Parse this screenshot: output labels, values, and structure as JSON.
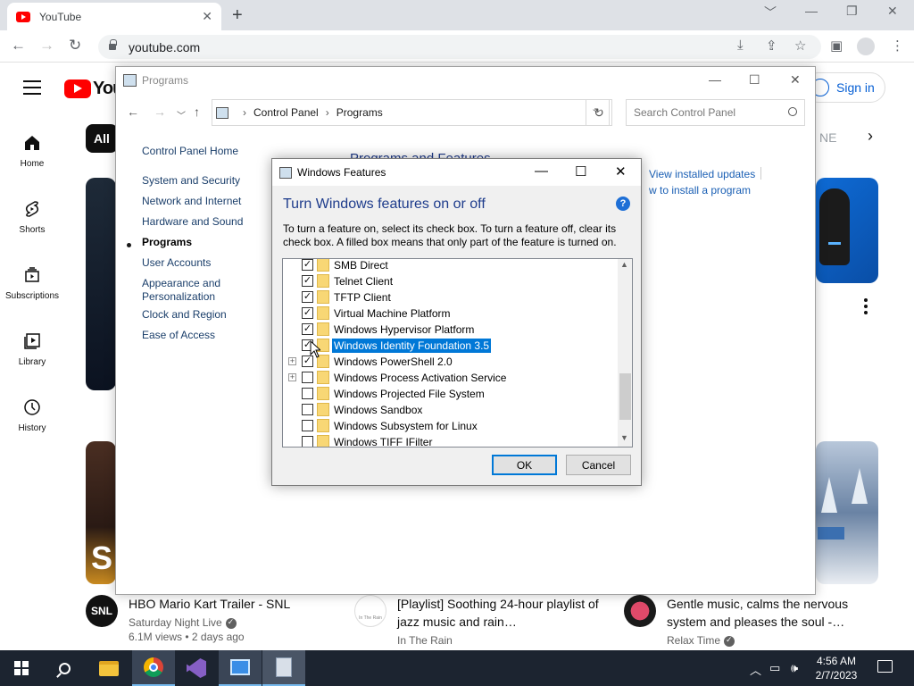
{
  "browser": {
    "tab_title": "YouTube",
    "tab_close": "✕",
    "new_tab": "+",
    "url": "youtube.com",
    "window_controls": [
      "﹀",
      "—",
      "❐",
      "✕"
    ]
  },
  "youtube": {
    "logo_text": "You",
    "sign_in": "Sign in",
    "nav": [
      {
        "label": "Home"
      },
      {
        "label": "Shorts"
      },
      {
        "label": "Subscriptions"
      },
      {
        "label": "Library"
      },
      {
        "label": "History"
      }
    ],
    "chip_all": "All",
    "chip_partial": "NE",
    "thumb_mark": "S",
    "videos": [
      {
        "title": "HBO Mario Kart Trailer - SNL",
        "channel": "Saturday Night Live",
        "meta": "6.1M views • 2 days ago",
        "avatar_text": "SNL",
        "verified": true
      },
      {
        "title": "[Playlist] Soothing 24-hour playlist of jazz music and rain…",
        "channel": "In The Rain",
        "meta": "",
        "avatar_text": "In The Rain",
        "verified": false
      },
      {
        "title": "Gentle music, calms the nervous system and pleases the soul -…",
        "channel": "Relax Time",
        "meta": "",
        "avatar_text": "",
        "verified": true
      }
    ]
  },
  "control_panel": {
    "title": "Programs",
    "breadcrumb": [
      "Control Panel",
      "Programs"
    ],
    "search_placeholder": "Search Control Panel",
    "sidebar": {
      "home": "Control Panel Home",
      "items": [
        "System and Security",
        "Network and Internet",
        "Hardware and Sound",
        "Programs",
        "User Accounts",
        "Appearance and Personalization",
        "Clock and Region",
        "Ease of Access"
      ],
      "current": "Programs"
    },
    "section_heading": "Programs and Features",
    "links": [
      "View installed updates",
      "w to install a program"
    ]
  },
  "windows_features": {
    "title": "Windows Features",
    "heading": "Turn Windows features on or off",
    "description": "To turn a feature on, select its check box. To turn a feature off, clear its check box. A filled box means that only part of the feature is turned on.",
    "help": "?",
    "features": [
      {
        "name": "SMB Direct",
        "checked": true,
        "expandable": false,
        "selected": false
      },
      {
        "name": "Telnet Client",
        "checked": true,
        "expandable": false,
        "selected": false
      },
      {
        "name": "TFTP Client",
        "checked": true,
        "expandable": false,
        "selected": false
      },
      {
        "name": "Virtual Machine Platform",
        "checked": true,
        "expandable": false,
        "selected": false
      },
      {
        "name": "Windows Hypervisor Platform",
        "checked": true,
        "expandable": false,
        "selected": false
      },
      {
        "name": "Windows Identity Foundation 3.5",
        "checked": true,
        "expandable": false,
        "selected": true
      },
      {
        "name": "Windows PowerShell 2.0",
        "checked": true,
        "expandable": true,
        "selected": false
      },
      {
        "name": "Windows Process Activation Service",
        "checked": false,
        "expandable": true,
        "selected": false
      },
      {
        "name": "Windows Projected File System",
        "checked": false,
        "expandable": false,
        "selected": false
      },
      {
        "name": "Windows Sandbox",
        "checked": false,
        "expandable": false,
        "selected": false
      },
      {
        "name": "Windows Subsystem for Linux",
        "checked": false,
        "expandable": false,
        "selected": false
      },
      {
        "name": "Windows TIFF IFilter",
        "checked": false,
        "expandable": false,
        "selected": false
      }
    ],
    "ok_label": "OK",
    "cancel_label": "Cancel"
  },
  "taskbar": {
    "apps": [
      "start-icon",
      "search-icon",
      "file-explorer-icon",
      "chrome-icon",
      "visual-studio-icon",
      "control-panel-icon",
      "windows-features-icon"
    ],
    "time": "4:56 AM",
    "date": "2/7/2023"
  },
  "colors": {
    "yt_red": "#ff0000",
    "link_blue": "#065fd4",
    "selection": "#0078d7",
    "taskbar": "#1c2430"
  }
}
